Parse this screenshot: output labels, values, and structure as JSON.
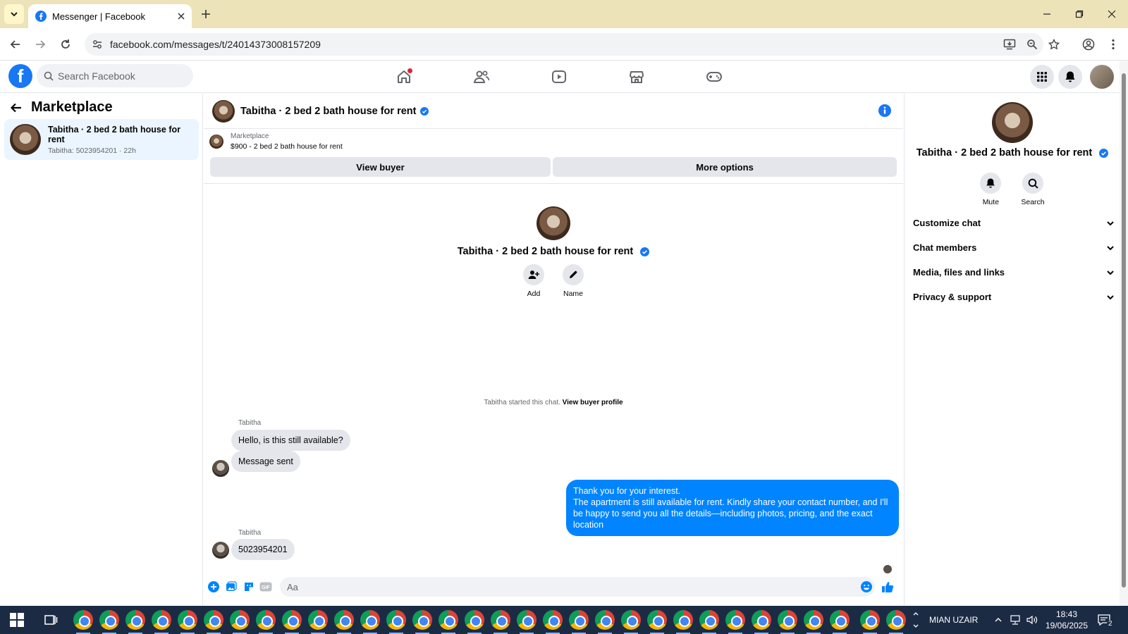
{
  "browser": {
    "tab_title": "Messenger | Facebook",
    "url": "facebook.com/messages/t/24014373008157209"
  },
  "facebook": {
    "search_placeholder": "Search Facebook"
  },
  "left": {
    "header": "Marketplace",
    "conversation": {
      "name": "Tabitha · 2 bed 2 bath house for rent",
      "preview": "Tabitha: 5023954201 · 22h"
    }
  },
  "chat": {
    "title": "Tabitha · 2 bed 2 bath house for rent",
    "marketplace_label": "Marketplace",
    "listing": "$900 - 2 bed 2 bath house for rent",
    "view_buyer": "View buyer",
    "more_options": "More options",
    "profile_name": "Tabitha · 2 bed 2 bath house for rent",
    "add_label": "Add",
    "name_label": "Name",
    "started_text": "Tabitha started this chat.",
    "view_buyer_profile": "View buyer profile",
    "messages": [
      {
        "sender": "Tabitha",
        "text": "Hello, is this still available?"
      },
      {
        "text": "Message sent"
      },
      {
        "outgoing": true,
        "lines": [
          "Thank you for your interest.",
          "The apartment is still available for rent. Kindly share your contact number, and I'll be happy to send you all the details—including photos, pricing, and the exact location"
        ]
      },
      {
        "sender": "Tabitha",
        "text": "5023954201"
      }
    ],
    "composer_placeholder": "Aa"
  },
  "right": {
    "name": "Tabitha · 2 bed 2 bath house for rent",
    "mute": "Mute",
    "search": "Search",
    "sections": [
      "Customize chat",
      "Chat members",
      "Media, files and links",
      "Privacy & support"
    ]
  },
  "taskbar": {
    "user": "MIAN UZAIR",
    "time": "18:43",
    "date": "19/06/2025",
    "notification_count": "2"
  },
  "colors": {
    "brand": "#1877f2",
    "outgoing_bubble": "#0084ff",
    "tab_strip": "#ece4b8",
    "taskbar": "#1c2b44"
  }
}
